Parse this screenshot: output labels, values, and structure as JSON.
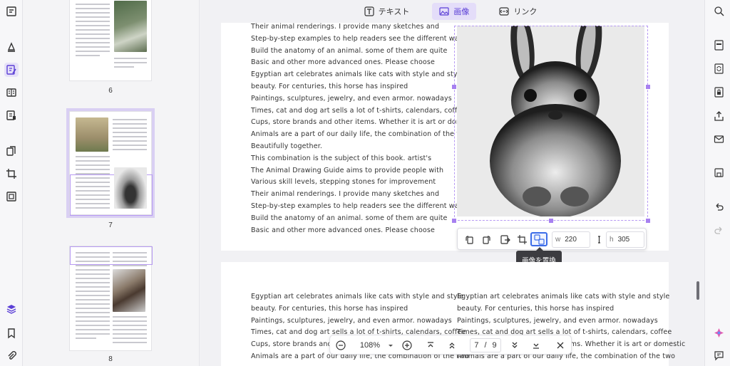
{
  "top_tabs": [
    {
      "label": "テキスト",
      "icon": "text-icon"
    },
    {
      "label": "画像",
      "icon": "image-icon",
      "active": true
    },
    {
      "label": "リンク",
      "icon": "link-icon"
    }
  ],
  "thumbnails": [
    {
      "page": "6"
    },
    {
      "page": "7"
    },
    {
      "page": "8"
    }
  ],
  "page1_lines": [
    "Their animal renderings. I provide many sketches and",
    "Step-by-step examples to help readers see the different ways",
    "Build the anatomy of an animal. some of them are quite",
    "Basic and other more advanced ones. Please choose",
    "Egyptian art celebrates animals like cats with style and style",
    "beauty. For centuries, this horse has inspired",
    "Paintings, sculptures, jewelry, and even armor. nowadays",
    "Times, cat and dog art sells a lot of t-shirts, calendars, coffee",
    "Cups, store brands and other items. Whether it is art or domestic",
    "Animals are a part of our daily life, the combination of the two",
    "Beautifully together.",
    "This combination is the subject of this book. artist's",
    "The Animal Drawing Guide aims to provide people with",
    "Various skill levels, stepping stones for improvement",
    "Their animal renderings. I provide many sketches and",
    "Step-by-step examples to help readers see the different ways",
    "Build the anatomy of an animal. some of them are quite",
    "Basic and other more advanced ones. Please choose"
  ],
  "page2_left": [
    "Egyptian art celebrates animals like cats with style and style",
    "beauty. For centuries, this horse has inspired",
    "Paintings, sculptures, jewelry, and even armor. nowadays",
    "Times, cat and dog art sells a lot of t-shirts, calendars, coffee",
    "Cups, store brands and other items. Whether it is art or domestic",
    "Animals are a part of our daily life, the combination of the two"
  ],
  "page2_right": [
    "Egyptian art celebrates animals like cats with style and style",
    "beauty. For centuries, this horse has inspired",
    "Paintings, sculptures, jewelry, and even armor. nowadays",
    "Times, cat and dog art sells a lot of t-shirts, calendars, coffee",
    "Cups, store brands and other items. Whether it is art or domestic",
    "Animals are a part of our daily life, the combination of the two"
  ],
  "image_toolbar": {
    "width_label": "w",
    "width_value": "220",
    "height_label": "h",
    "height_value": "305",
    "tooltip": "画像を置換"
  },
  "bottom_nav": {
    "zoom": "108%",
    "current_page": "7",
    "separator": "/",
    "total_pages": "9"
  },
  "colors": {
    "accent": "#5b3fd6",
    "selection": "#a780f0",
    "active_tool": "#3b6ce8"
  }
}
